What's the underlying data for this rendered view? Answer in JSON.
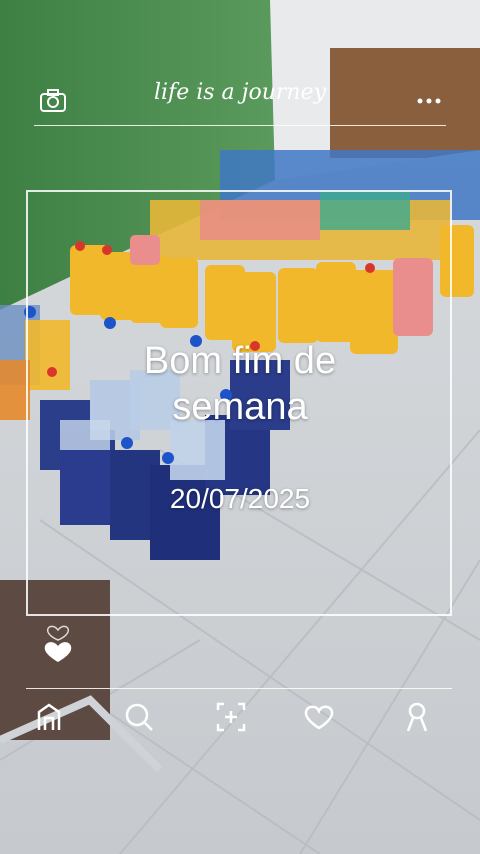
{
  "overlay": {
    "tagline": "life is a journey",
    "message": "Bom fim de semana",
    "date": "20/07/2025"
  },
  "icons": {
    "top_left": "camera-icon",
    "top_right": "more-icon",
    "side": "hearts-icon",
    "nav": [
      "home-icon",
      "search-icon",
      "add-frame-icon",
      "heart-icon",
      "profile-icon"
    ]
  },
  "colors": {
    "wall_green": "#4a8a4f",
    "floor_tile": "#d9dcdf",
    "overlay_white": "#ffffff"
  }
}
